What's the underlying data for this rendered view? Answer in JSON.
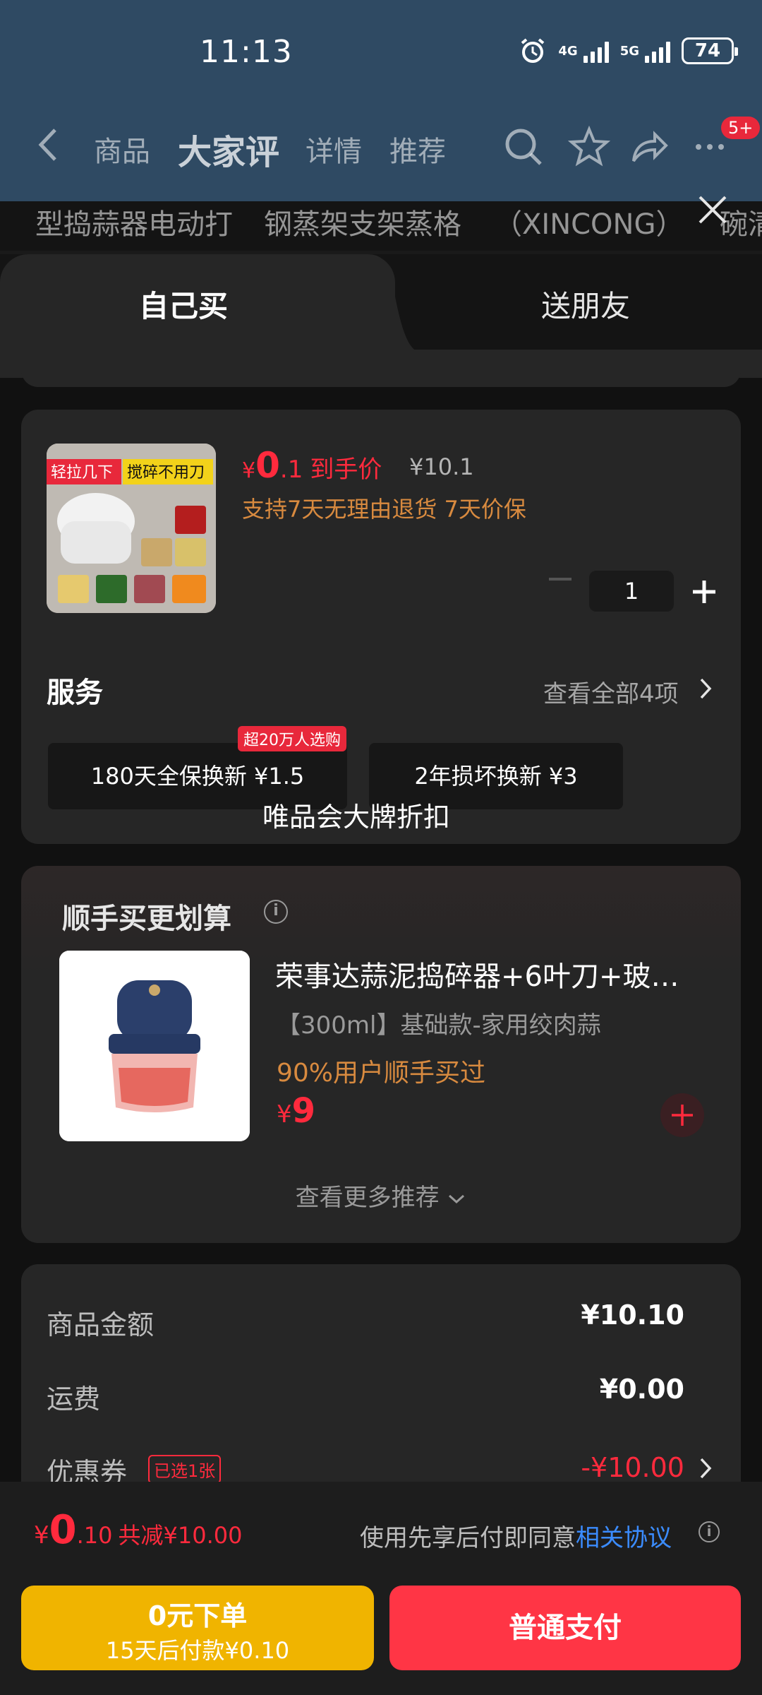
{
  "status": {
    "time": "11:13",
    "battery": "74",
    "net1": "4G",
    "net2": "5G"
  },
  "nav": {
    "tabs": [
      "商品",
      "大家评",
      "详情",
      "推荐"
    ],
    "active_tab": "大家评",
    "badge": "5+"
  },
  "strip": [
    "型捣蒜器电动打",
    "钢蒸架支架蒸格",
    "（XINCONG）",
    "碗清"
  ],
  "sheet_tabs": {
    "mine": "自己买",
    "gift": "送朋友"
  },
  "product": {
    "price_symbol": "¥",
    "price_int": "0",
    "price_dec": ".1",
    "price_label": "到手价",
    "original_price": "¥10.1",
    "guarantee": "支持7天无理由退货  7天价保",
    "quantity": "1",
    "image_tags": [
      "轻拉几下",
      "搅碎不用刀"
    ]
  },
  "services": {
    "title": "服务",
    "view_all": "查看全部4项",
    "items": [
      {
        "label": "180天全保换新  ¥1.5",
        "tag": "超20万人选购"
      },
      {
        "label": "2年损坏换新  ¥3"
      }
    ],
    "overlay": "唯品会大牌折扣"
  },
  "addon": {
    "title": "顺手买更划算",
    "name": "荣事达蒜泥捣碎器+6叶刀+玻…",
    "spec": "【300ml】基础款-家用绞肉蒜",
    "rate": "90%用户顺手买过",
    "price_symbol": "¥",
    "price": "9",
    "more": "查看更多推荐"
  },
  "summary": {
    "goods_label": "商品金额",
    "goods_value": "¥10.10",
    "shipping_label": "运费",
    "shipping_value": "¥0.00",
    "coupon_label": "优惠券",
    "coupon_tag": "已选1张",
    "coupon_value": "-¥10.00"
  },
  "footer": {
    "total_symbol": "¥",
    "total_int": "0",
    "total_dec": ".10",
    "total_cut": "共减¥10.00",
    "agree_text": "使用先享后付即同意",
    "agree_link": "相关协议",
    "btn_zero_line1": "0元下单",
    "btn_zero_line2": "15天后付款¥0.10",
    "btn_pay": "普通支付"
  },
  "colors": {
    "accent_red": "#ff2a3d",
    "accent_orange": "#d88a3f",
    "yellow_button": "#f0b400",
    "pay_button": "#ff3545",
    "link_blue": "#3b8cff"
  }
}
